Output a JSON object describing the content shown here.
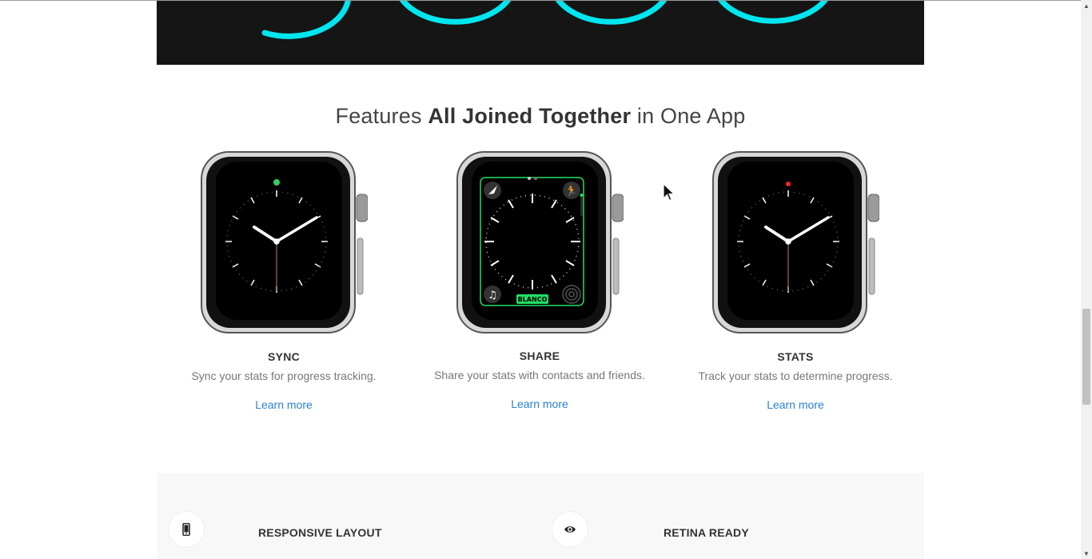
{
  "features_section": {
    "title_pre": "Features ",
    "title_bold": "All Joined Together",
    "title_post": " in One App",
    "items": [
      {
        "title": "SYNC",
        "description": "Sync your stats for progress tracking.",
        "link": "Learn more",
        "face": "analog",
        "accent": "#33cc66"
      },
      {
        "title": "SHARE",
        "description": "Share your stats with contacts and friends.",
        "link": "Learn more",
        "face": "modular",
        "accent": "#22dd66",
        "face_label": "BLANCO"
      },
      {
        "title": "STATS",
        "description": "Track your stats to determine progress.",
        "link": "Learn more",
        "face": "analog",
        "accent": "#ff2222"
      }
    ]
  },
  "hero": {
    "background": "#151515",
    "ring_color": "#00e5ee"
  },
  "highlights": [
    {
      "title": "RESPONSIVE LAYOUT",
      "icon": "mobile-phone-icon"
    },
    {
      "title": "RETINA READY",
      "icon": "eye-icon"
    }
  ],
  "colors": {
    "link": "#2a7fd4",
    "text": "#333333",
    "muted": "#777777",
    "band": "#f8f8f8"
  }
}
